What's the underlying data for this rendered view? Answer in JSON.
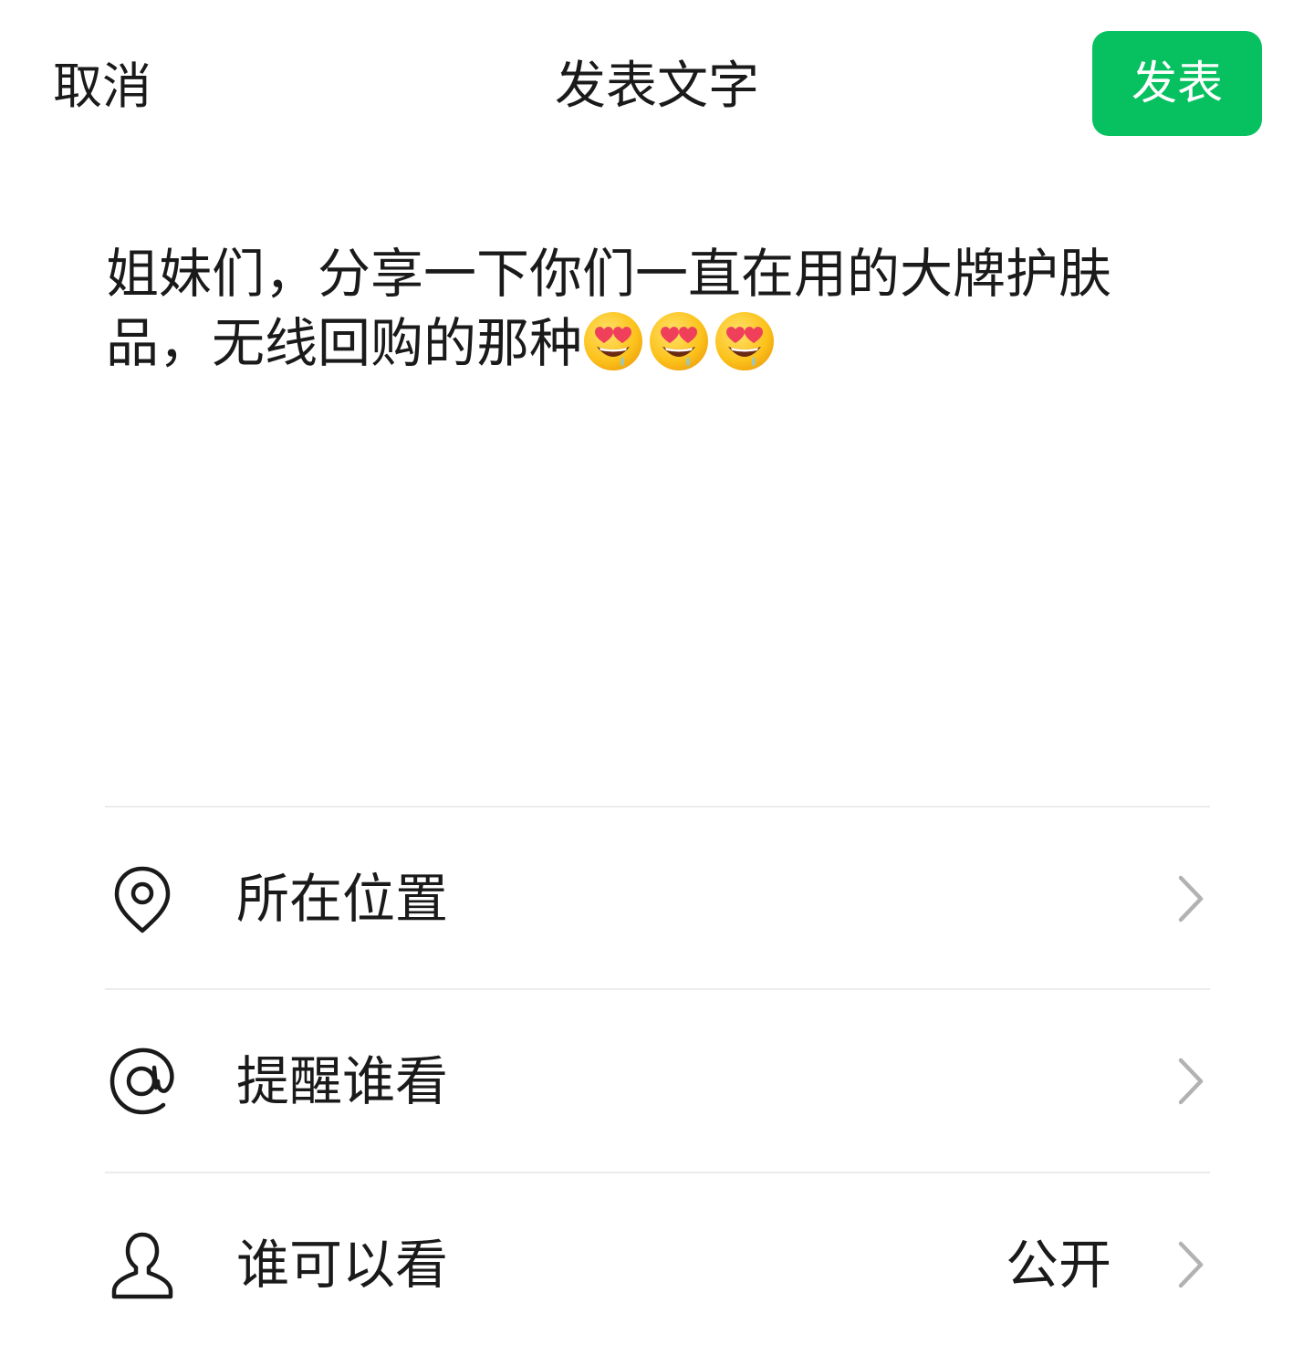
{
  "header": {
    "cancel_label": "取消",
    "title": "发表文字",
    "publish_label": "发表"
  },
  "post": {
    "text": "姐妹们，分享一下你们一直在用的大牌护肤品，无线回购的那种",
    "emoji_icons": [
      "smiling-face-with-heart-eyes-icon",
      "smiling-face-with-heart-eyes-icon",
      "smiling-face-with-heart-eyes-icon"
    ]
  },
  "options": [
    {
      "icon": "location-pin-icon",
      "label": "所在位置",
      "value": ""
    },
    {
      "icon": "at-sign-icon",
      "label": "提醒谁看",
      "value": ""
    },
    {
      "icon": "person-icon",
      "label": "谁可以看",
      "value": "公开"
    }
  ],
  "colors": {
    "accent": "#07c160",
    "text": "#1a1a1a",
    "chevron": "#b2b2b2",
    "divider": "#ececec"
  }
}
